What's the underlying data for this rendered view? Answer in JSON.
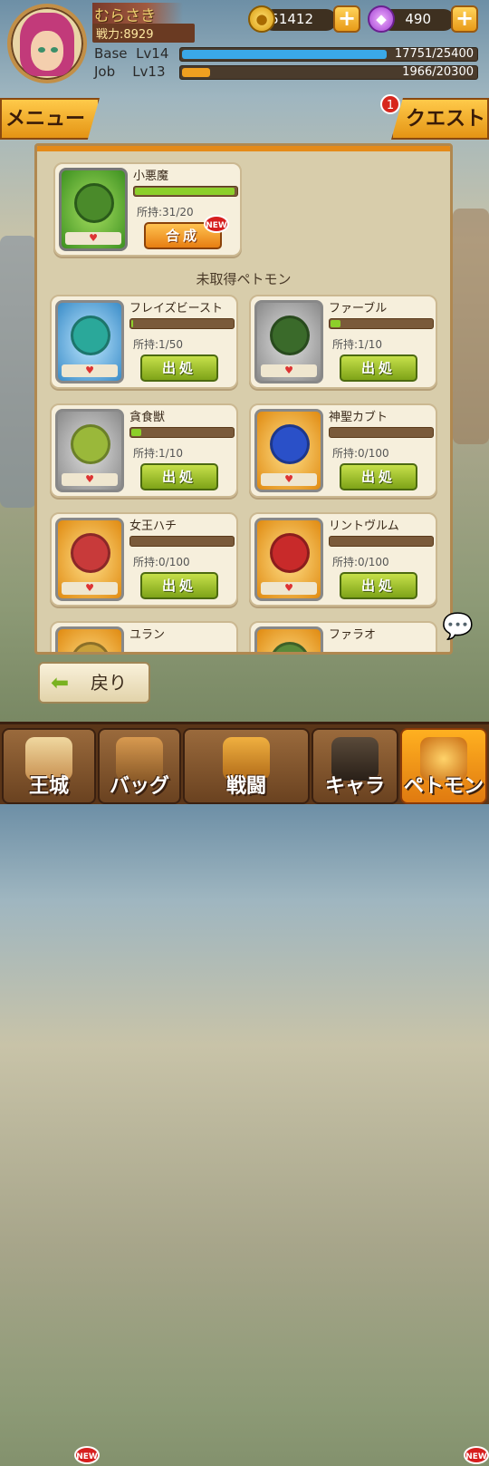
{
  "player": {
    "name": "むらさき",
    "power": "戦力:8929"
  },
  "currency": {
    "gold": "51412",
    "gems": "490"
  },
  "levels": [
    {
      "label": "Base",
      "level": "Lv14",
      "value": "17751/25400",
      "progress": 0.699
    },
    {
      "label": "Job",
      "level": "Lv13",
      "value": "1966/20300",
      "progress": 0.097
    }
  ],
  "menu_label": "メニュー",
  "quest": {
    "label": "クエスト",
    "badge": "1"
  },
  "owned_pet": {
    "name": "小悪魔",
    "count": "所持:31/20",
    "button": "合成",
    "new": "NEW",
    "progress": 1.0
  },
  "section_title": "未取得ペトモン",
  "pets": [
    {
      "name": "フレイズビースト",
      "count": "所持:1/50",
      "button": "出処",
      "progress": 0.02
    },
    {
      "name": "ファーブル",
      "count": "所持:1/10",
      "button": "出処",
      "progress": 0.1
    },
    {
      "name": "貪食獣",
      "count": "所持:1/10",
      "button": "出処",
      "progress": 0.1
    },
    {
      "name": "神聖カブト",
      "count": "所持:0/100",
      "button": "出処",
      "progress": 0
    },
    {
      "name": "女王ハチ",
      "count": "所持:0/100",
      "button": "出処",
      "progress": 0
    },
    {
      "name": "リントヴルム",
      "count": "所持:0/100",
      "button": "出処",
      "progress": 0
    },
    {
      "name": "ユラン",
      "count": "",
      "button": "",
      "progress": 0
    },
    {
      "name": "ファラオ",
      "count": "",
      "button": "",
      "progress": 0
    }
  ],
  "back_label": "戻り",
  "nav": [
    {
      "label": "王城",
      "new": "NEW"
    },
    {
      "label": "バッグ"
    },
    {
      "label": "戦闘"
    },
    {
      "label": "キャラ"
    },
    {
      "label": "ペトモン",
      "new": "NEW"
    }
  ],
  "icons": {
    "heart": "♥",
    "arrow": "⬅",
    "chat": "💬",
    "plus": "+",
    "coin": "●",
    "gem": "◆"
  },
  "colors": {
    "accent": "#e58a18",
    "progress_green": "#8ccf2a",
    "exp_blue": "#3aa8e8",
    "exp_orange": "#f0a020"
  }
}
